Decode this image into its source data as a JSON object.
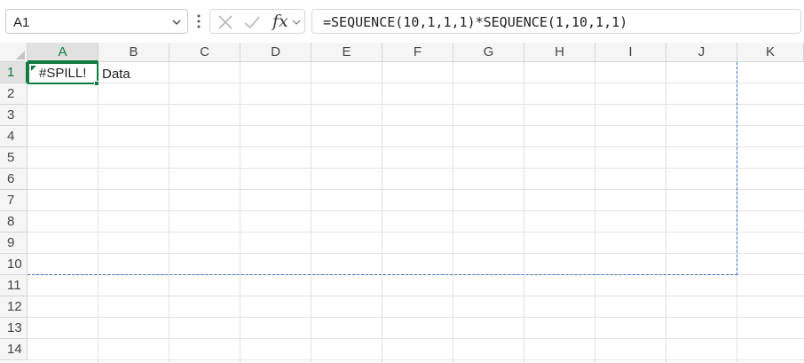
{
  "formula_bar": {
    "name_box": "A1",
    "fx_label": "fx",
    "formula": "=SEQUENCE(10,1,1,1)*SEQUENCE(1,10,1,1)"
  },
  "columns": [
    "A",
    "B",
    "C",
    "D",
    "E",
    "F",
    "G",
    "H",
    "I",
    "J",
    "K"
  ],
  "rows": [
    "1",
    "2",
    "3",
    "4",
    "5",
    "6",
    "7",
    "8",
    "9",
    "10",
    "11",
    "12",
    "13",
    "14"
  ],
  "cells": {
    "A1": "#SPILL!",
    "B1": "Data"
  },
  "colors": {
    "selection": "#107c41",
    "spill_border": "#3b6cc4"
  },
  "icons": {
    "name_box_dropdown": "chevron-down-icon",
    "more": "kebab-menu-icon",
    "cancel": "close-icon",
    "enter": "check-icon",
    "function": "fx-icon"
  }
}
